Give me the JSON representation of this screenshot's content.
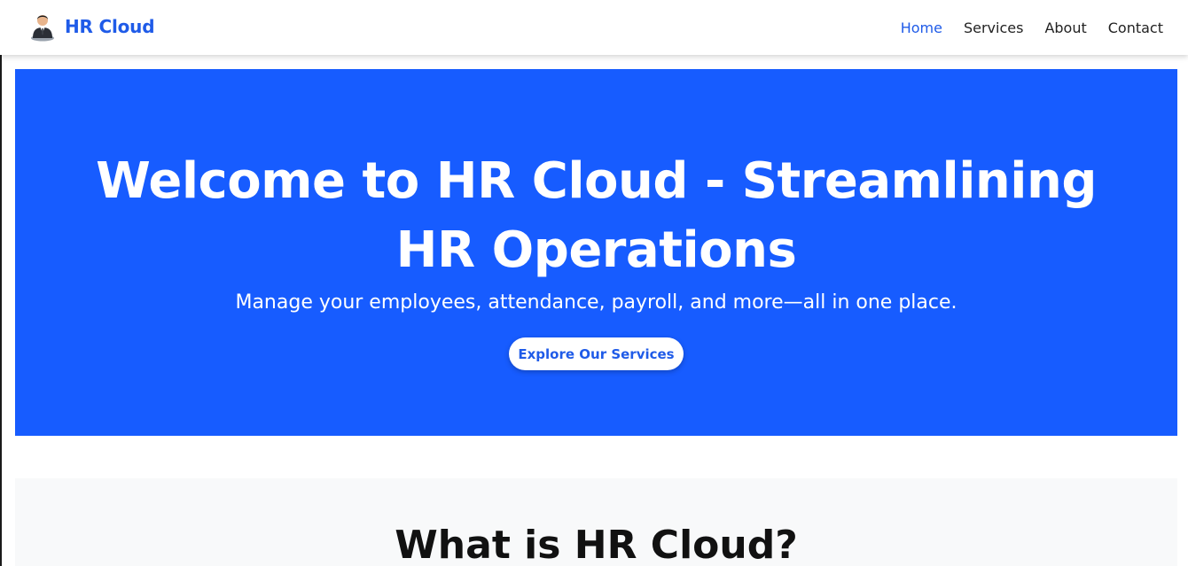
{
  "navbar": {
    "brand": {
      "icon": "businessman-avatar-icon",
      "name": "HR Cloud"
    },
    "links": [
      {
        "label": "Home",
        "active": true
      },
      {
        "label": "Services",
        "active": false
      },
      {
        "label": "About",
        "active": false
      },
      {
        "label": "Contact",
        "active": false
      }
    ]
  },
  "hero": {
    "title": "Welcome to HR Cloud - Streamlining HR Operations",
    "subtitle": "Manage your employees, attendance, payroll, and more—all in one place.",
    "cta_label": "Explore Our Services"
  },
  "about": {
    "title": "What is HR Cloud?"
  },
  "colors": {
    "primary": "#175cff",
    "brand_text": "#1f5be8",
    "section_bg": "#f8f9fa",
    "white": "#ffffff"
  }
}
